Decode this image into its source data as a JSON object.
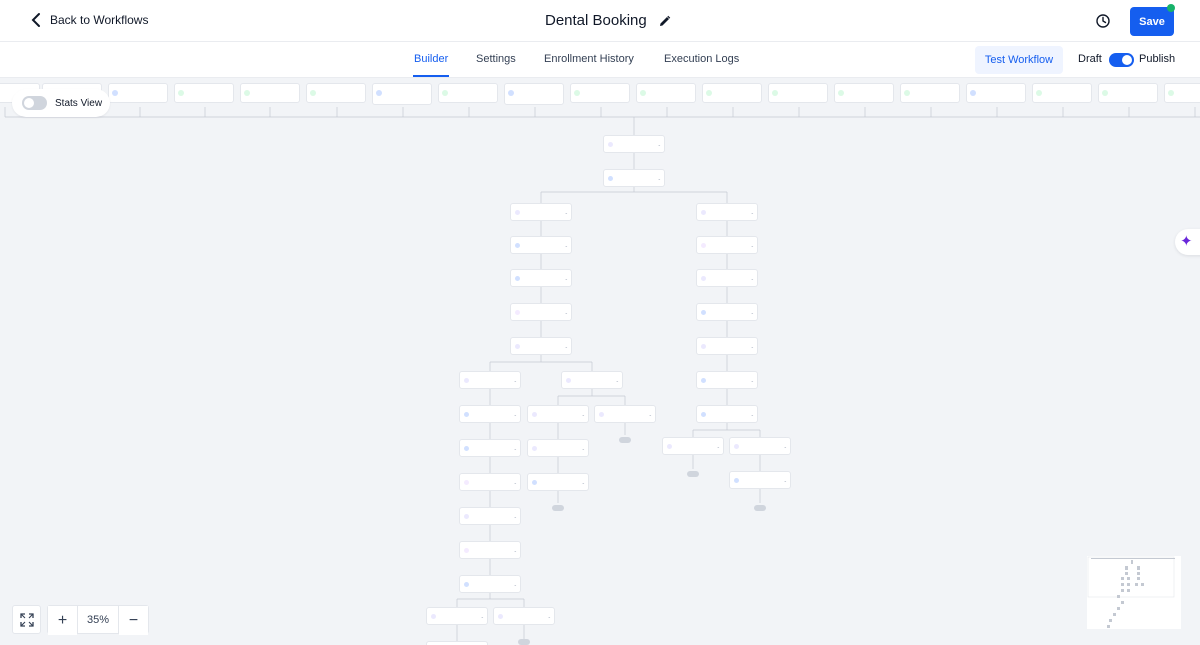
{
  "header": {
    "back_label": "Back to Workflows",
    "title": "Dental Booking",
    "save_label": "Save"
  },
  "tabs": [
    {
      "label": "Builder",
      "active": true
    },
    {
      "label": "Settings",
      "active": false
    },
    {
      "label": "Enrollment History",
      "active": false
    },
    {
      "label": "Execution Logs",
      "active": false
    }
  ],
  "toolbar": {
    "test_label": "Test Workflow",
    "draft_label": "Draft",
    "publish_label": "Publish",
    "publish_on": true
  },
  "stats": {
    "label": "Stats View",
    "on": false
  },
  "zoom": {
    "value": "35%"
  },
  "colors": {
    "accent": "#155eef",
    "status_dot": "#17b26a",
    "ai": "#6927da"
  }
}
